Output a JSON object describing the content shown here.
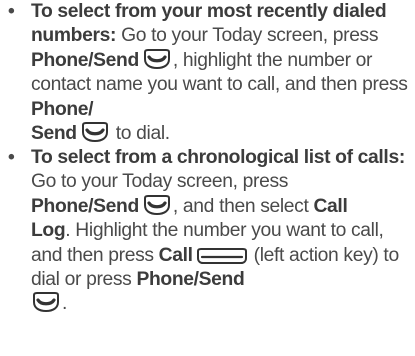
{
  "bullet_glyph": "•",
  "items": [
    {
      "lead": "To select from your most recently dialed numbers:",
      "t1": " Go to your Today screen, press ",
      "phone_send_1": "Phone/Send",
      "t2": ", highlight the number or contact name you want to call, and then press ",
      "phone_send_2a": "Phone/",
      "phone_send_2b": "Send",
      "t3": " to dial."
    },
    {
      "lead": "To select from a chronological list of calls:",
      "t1": " Go to your Today screen, press ",
      "phone_send_1": "Phone/Send",
      "t2": ", and then select ",
      "call_log_a": "Call",
      "call_log_b": "Log",
      "t3": ". Highlight the number you want to call, and then press ",
      "call": "Call",
      "t4": " (left action key) to dial or press ",
      "phone_send_2": "Phone/Send",
      "t5": "."
    }
  ],
  "icons": {
    "phone_send_key": "phone-send-key-icon",
    "left_action_key": "left-action-key-icon"
  },
  "colors": {
    "text": "#4a4a4a",
    "bold_text": "#3c3c3c"
  }
}
